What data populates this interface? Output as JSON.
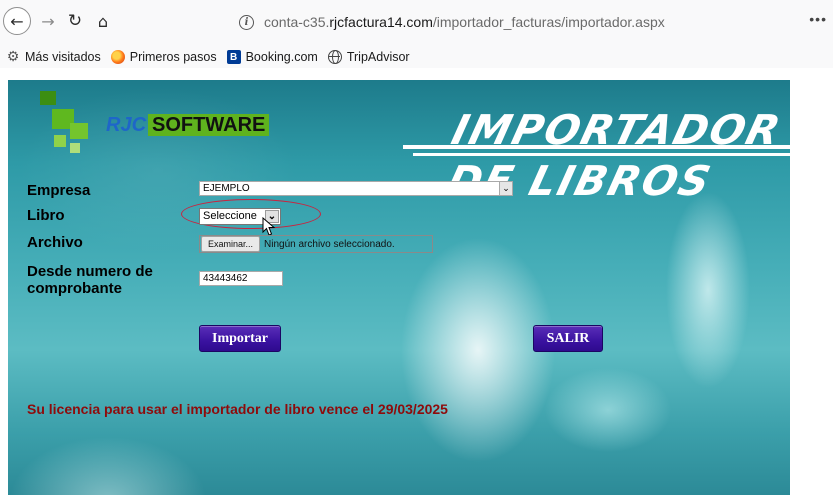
{
  "browser": {
    "url_prefix": "conta-c35.",
    "url_domain": "rjcfactura14.com",
    "url_path": "/importador_facturas/importador.aspx",
    "menu_label": "•••"
  },
  "bookmarks": [
    {
      "label": "Más visitados"
    },
    {
      "label": "Primeros pasos"
    },
    {
      "label": "Booking.com",
      "icon_text": "B"
    },
    {
      "label": "TripAdvisor"
    }
  ],
  "logo": {
    "part1": "RJC",
    "part2": "SOFTWARE"
  },
  "title": {
    "line1": "IMPORTADOR",
    "line2": "DE LIBROS"
  },
  "form": {
    "empresa_label": "Empresa",
    "empresa_value": "EJEMPLO",
    "libro_label": "Libro",
    "libro_value": "Seleccione",
    "archivo_label": "Archivo",
    "archivo_button": "Examinar...",
    "archivo_status": "Ningún archivo seleccionado.",
    "desde_label": "Desde numero de comprobante",
    "desde_value": "43443462"
  },
  "buttons": {
    "importar": "Importar",
    "salir": "SALIR"
  },
  "license_text": "Su licencia para usar el importador de libro vence el 29/03/2025",
  "colors": {
    "action_button": "#3a12a0",
    "license_text": "#8e0b0b",
    "highlight_ellipse": "#c9243f",
    "logo_green": "#5fb31e",
    "logo_blue": "#1e66c9"
  }
}
